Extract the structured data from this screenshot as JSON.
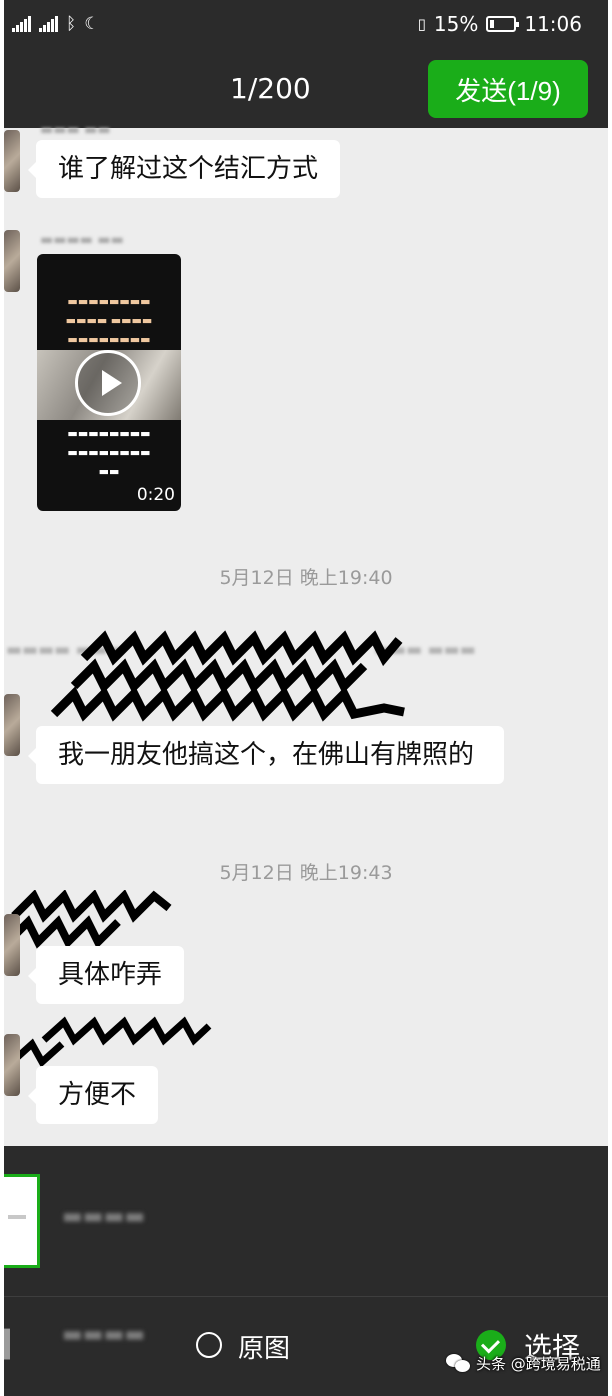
{
  "status_bar": {
    "battery_percent": "15%",
    "time": "11:06"
  },
  "header": {
    "counter": "1/200",
    "send_label": "发送(1/9)"
  },
  "messages": [
    {
      "type": "text",
      "text": "谁了解过这个结汇方式"
    },
    {
      "type": "video",
      "duration": "0:20"
    },
    {
      "type": "timestamp",
      "text": "5月12日 晚上19:40"
    },
    {
      "type": "text",
      "text": "我一朋友他搞这个，在佛山有牌照的"
    },
    {
      "type": "timestamp",
      "text": "5月12日 晚上19:43"
    },
    {
      "type": "text",
      "text": "具体咋弄"
    },
    {
      "type": "text",
      "text": "方便不"
    }
  ],
  "bottom_bar": {
    "original_label": "原图",
    "select_label": "选择"
  },
  "watermark": {
    "text": "头条 @跨境易税通"
  },
  "colors": {
    "dark_bar": "#2b2b2b",
    "accent_green": "#1aad19",
    "chat_bg": "#ededed",
    "bubble": "#ffffff"
  }
}
